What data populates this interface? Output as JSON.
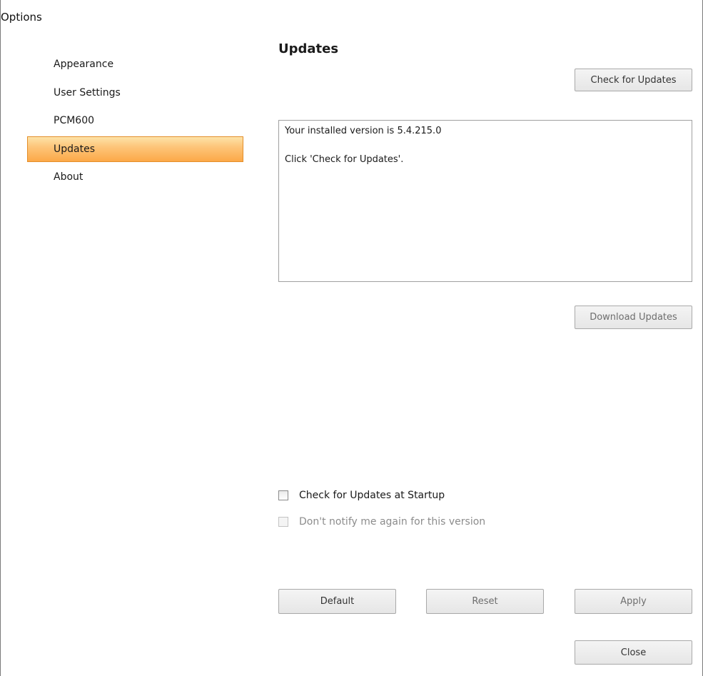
{
  "window": {
    "title": "Options"
  },
  "sidebar": {
    "items": [
      {
        "label": "Appearance"
      },
      {
        "label": "User Settings"
      },
      {
        "label": "PCM600"
      },
      {
        "label": "Updates",
        "selected": true
      },
      {
        "label": "About"
      }
    ]
  },
  "updates": {
    "title": "Updates",
    "check_button": "Check for Updates",
    "message_line1": "Your installed version is 5.4.215.0",
    "message_line2": "Click 'Check for Updates'.",
    "download_button": "Download Updates",
    "startup_checkbox": {
      "label": "Check for Updates at Startup",
      "checked": false
    },
    "notify_checkbox": {
      "label": "Don't notify me again for this version",
      "checked": false,
      "enabled": false
    }
  },
  "footer": {
    "default_button": "Default",
    "reset_button": "Reset",
    "apply_button": "Apply",
    "close_button": "Close"
  },
  "colors": {
    "selection_top": "#fde3a8",
    "selection_bottom": "#fca948",
    "selection_border": "#e38e2a"
  }
}
